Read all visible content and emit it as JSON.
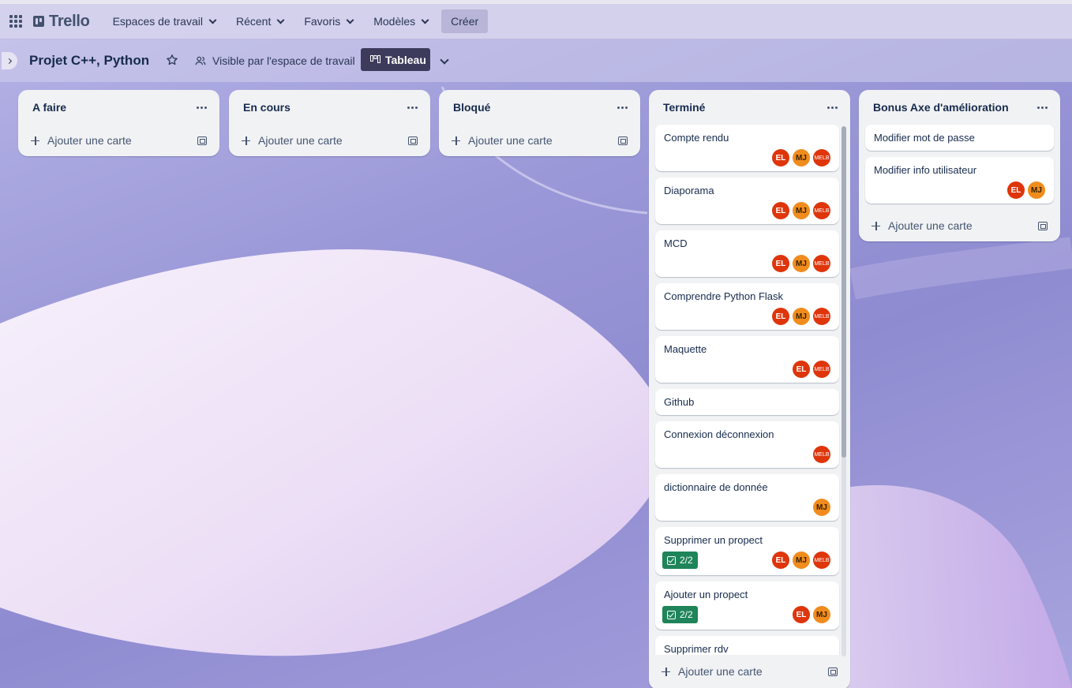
{
  "topnav": {
    "logo": "Trello",
    "items": [
      "Espaces de travail",
      "Récent",
      "Favoris",
      "Modèles"
    ],
    "create": "Créer"
  },
  "board": {
    "title": "Projet C++, Python",
    "visibility": "Visible par l'espace de travail",
    "view": "Tableau"
  },
  "add_card_label": "Ajouter une carte",
  "lists": [
    {
      "title": "A faire",
      "cards": []
    },
    {
      "title": "En cours",
      "cards": []
    },
    {
      "title": "Bloqué",
      "cards": []
    },
    {
      "title": "Terminé",
      "cards": [
        {
          "title": "Compte rendu",
          "members": [
            "EL",
            "MJ",
            "MELB"
          ]
        },
        {
          "title": "Diaporama",
          "members": [
            "EL",
            "MJ",
            "MELB"
          ]
        },
        {
          "title": "MCD",
          "members": [
            "EL",
            "MJ",
            "MELB"
          ]
        },
        {
          "title": "Comprendre Python Flask",
          "members": [
            "EL",
            "MJ",
            "MELB"
          ]
        },
        {
          "title": "Maquette",
          "members": [
            "EL",
            "MELB"
          ]
        },
        {
          "title": "Github",
          "members": []
        },
        {
          "title": "Connexion déconnexion",
          "members": [
            "MELB"
          ]
        },
        {
          "title": "dictionnaire de donnée",
          "members": [
            "MJ"
          ]
        },
        {
          "title": "Supprimer un propect",
          "checklist": "2/2",
          "members": [
            "EL",
            "MJ",
            "MELB"
          ]
        },
        {
          "title": "Ajouter un propect",
          "checklist": "2/2",
          "members": [
            "EL",
            "MJ"
          ]
        },
        {
          "title": "Supprimer rdv",
          "members": []
        }
      ]
    },
    {
      "title": "Bonus Axe d'amélioration",
      "cards": [
        {
          "title": "Modifier mot de passe",
          "members": []
        },
        {
          "title": "Modifier info utilisateur",
          "members": [
            "EL",
            "MJ"
          ]
        }
      ]
    }
  ]
}
